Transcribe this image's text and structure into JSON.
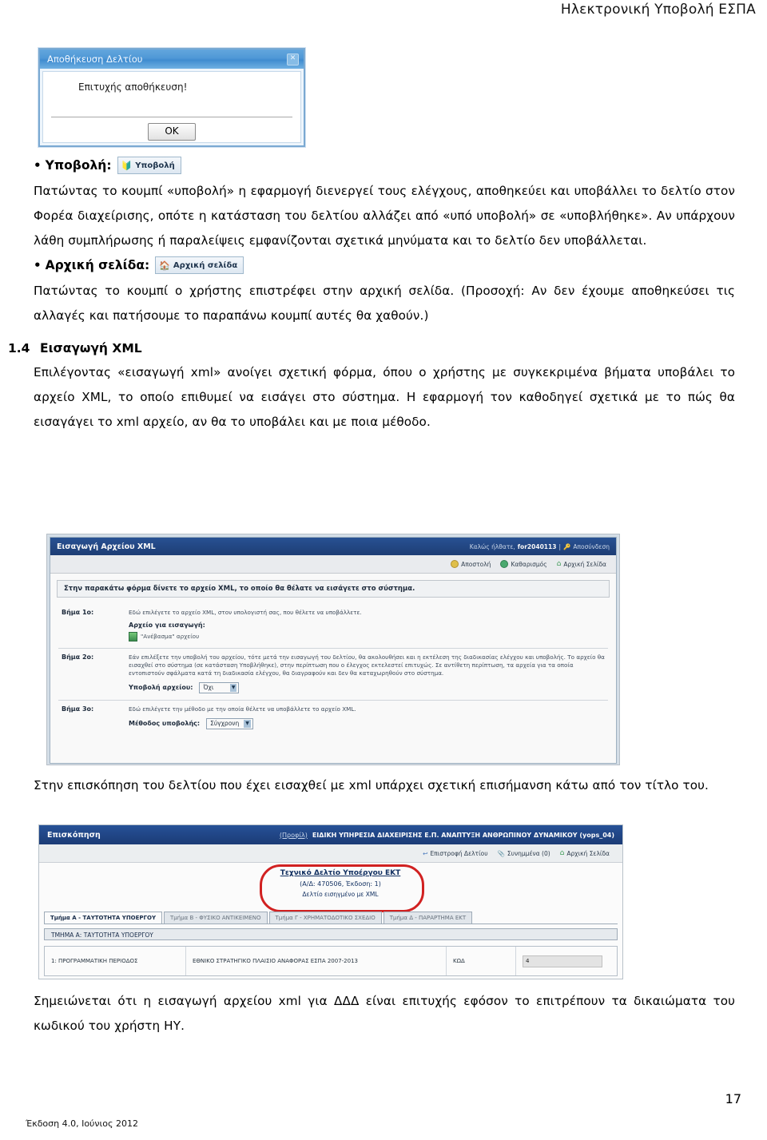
{
  "header": {
    "title": "Ηλεκτρονική Υποβολή ΕΣΠΑ"
  },
  "dialog": {
    "title": "Αποθήκευση Δελτίου",
    "message": "Επιτυχής αποθήκευση!",
    "ok_label": "OK",
    "close_label": "✕"
  },
  "content": {
    "bullet_submit_label": "Υποβολή:",
    "chip_submit_label": "Υποβολή",
    "para_submit": "Πατώντας το κουμπί «υποβολή» η εφαρμογή διενεργεί τους ελέγχους, αποθηκεύει και υποβάλλει το δελτίο στον Φορέα διαχείρισης, οπότε η κατάσταση του δελτίου αλλάζει από «υπό υποβολή» σε «υποβλήθηκε». Αν υπάρχουν λάθη συμπλήρωσης ή παραλείψεις εμφανίζονται σχετικά μηνύματα και το δελτίο δεν υποβάλλεται.",
    "bullet_home_label": "Αρχική σελίδα:",
    "chip_home_label": "Αρχική σελίδα",
    "para_home": "Πατώντας το κουμπί ο χρήστης επιστρέφει στην αρχική σελίδα. (Προσοχή: Αν δεν έχουμε αποθηκεύσει τις αλλαγές και πατήσουμε το παραπάνω κουμπί αυτές θα χαθούν.)",
    "section_number": "1.4",
    "section_title": "Εισαγωγή XML",
    "para_xml": "Επιλέγοντας «εισαγωγή xml» ανοίγει σχετική φόρμα, όπου ο χρήστης με συγκεκριμένα βήματα υποβάλει το αρχείο XML, το οποίο επιθυμεί να εισάγει στο σύστημα. Η εφαρμογή τον καθοδηγεί σχετικά με το πώς θα εισαγάγει το xml αρχείο, αν θα το υποβάλει και με ποια μέθοδο.",
    "para_overview": "Στην επισκόπηση του δελτίου που έχει εισαχθεί με xml υπάρχει σχετική επισήμανση κάτω από τον τίτλο του.",
    "para_note": "Σημειώνεται ότι η εισαγωγή αρχείου xml για ΔΔΔ είναι επιτυχής εφόσον το επιτρέπουν τα δικαιώματα του κωδικού του χρήστη ΗΥ."
  },
  "xml_screen": {
    "title": "Εισαγωγή Αρχείου XML",
    "welcome_prefix": "Καλώς ήλθατε,",
    "username": "for2040113",
    "separator": "|",
    "logout": "Αποσύνδεση",
    "toolbar": [
      {
        "label": "Αποστολή",
        "icon": "send-icon"
      },
      {
        "label": "Καθαρισμός",
        "icon": "clear-icon"
      },
      {
        "label": "Αρχική Σελίδα",
        "icon": "home-icon"
      }
    ],
    "notice": "Στην παρακάτω φόρμα δίνετε το αρχείο XML, το οποίο θα θέλατε να εισάγετε στο σύστημα.",
    "step1": {
      "label": "Βήμα 1ο:",
      "text": "Εδώ επιλέγετε το αρχείο XML, στον υπολογιστή σας, που θέλετε να υποβάλλετε.",
      "field_label": "Αρχείο για εισαγωγή:",
      "upload_link": "\"Ανέβασμα\" αρχείου"
    },
    "step2": {
      "label": "Βήμα 2ο:",
      "text": "Εάν επιλέξετε την υποβολή του αρχείου, τότε μετά την εισαγωγή του δελτίου, θα ακολουθήσει και η εκτέλεση της διαδικασίας ελέγχου και υποβολής. Το αρχείο θα εισαχθεί στο σύστημα (σε κατάσταση Υποβλήθηκε), στην περίπτωση που ο έλεγχος εκτελεστεί επιτυχώς. Σε αντίθετη περίπτωση, τα αρχεία για τα οποία εντοπιστούν σφάλματα κατά τη διαδικασία ελέγχου, θα διαγραφούν και δεν θα καταχωρηθούν στο σύστημα.",
      "field_label": "Υποβολή αρχείου:",
      "select_value": "Όχι"
    },
    "step3": {
      "label": "Βήμα 3ο:",
      "text": "Εδώ επιλέγετε την μέθοδο με την οποία θέλετε να υποβάλλετε το αρχείο XML.",
      "field_label": "Μέθοδος υποβολής:",
      "select_value": "Σύγχρονη"
    }
  },
  "overview_screen": {
    "title": "Επισκόπηση",
    "profile_link": "(Προφίλ)",
    "organization": "ΕΙΔΙΚΗ ΥΠΗΡΕΣΙΑ ΔΙΑΧΕΙΡΙΣΗΣ Ε.Π. ΑΝΑΠΤΥΞΗ ΑΝΘΡΩΠΙΝΟΥ ΔΥΝΑΜΙΚΟΥ (yops_04)",
    "toolbar": [
      {
        "label": "Επιστροφή Δελτίου",
        "icon": "back-arrow-icon"
      },
      {
        "label": "Συνημμένα (0)",
        "icon": "paperclip-icon"
      },
      {
        "label": "Αρχική Σελίδα",
        "icon": "home-icon"
      }
    ],
    "doc_title": "Τεχνικό Δελτίο Υποέργου ΕΚΤ",
    "doc_subtitle": "(Α/Δ: 470506, Έκδοση: 1)",
    "doc_note": "Δελτίο εισηγμένο με XML",
    "tabs": [
      "Τμήμα Α - ΤΑΥΤΟΤΗΤΑ ΥΠΟΕΡΓΟΥ",
      "Τμήμα Β - ΦΥΣΙΚΟ ΑΝΤΙΚΕΙΜΕΝΟ",
      "Τμήμα Γ - ΧΡΗΜΑΤΟΔΟΤΙΚΟ ΣΧΕΔΙΟ",
      "Τμήμα Δ - ΠΑΡΑΡΤΗΜΑ ΕΚΤ"
    ],
    "section_bar": "ΤΜΗΜΑ Α: ΤΑΥΤΟΤΗΤΑ ΥΠΟΕΡΓΟΥ",
    "row": {
      "c1": "1: ΠΡΟΓΡΑΜΜΑΤΙΚΗ ΠΕΡΙΟΔΟΣ",
      "c2": "ΕΘΝΙΚΟ ΣΤΡΑΤΗΓΙΚΟ ΠΛΑΙΣΙΟ ΑΝΑΦΟΡΑΣ ΕΣΠΑ 2007-2013",
      "c3": "ΚΩΔ",
      "c4": "4"
    }
  },
  "footer": {
    "page_number": "17",
    "version": "Έκδοση 4.0, Ιούνιος 2012"
  },
  "colors": {
    "accent_blue": "#1f4f9c",
    "dialog_blue": "#4f98d6",
    "alert_red": "#e01b1b",
    "green": "#3aa155"
  }
}
